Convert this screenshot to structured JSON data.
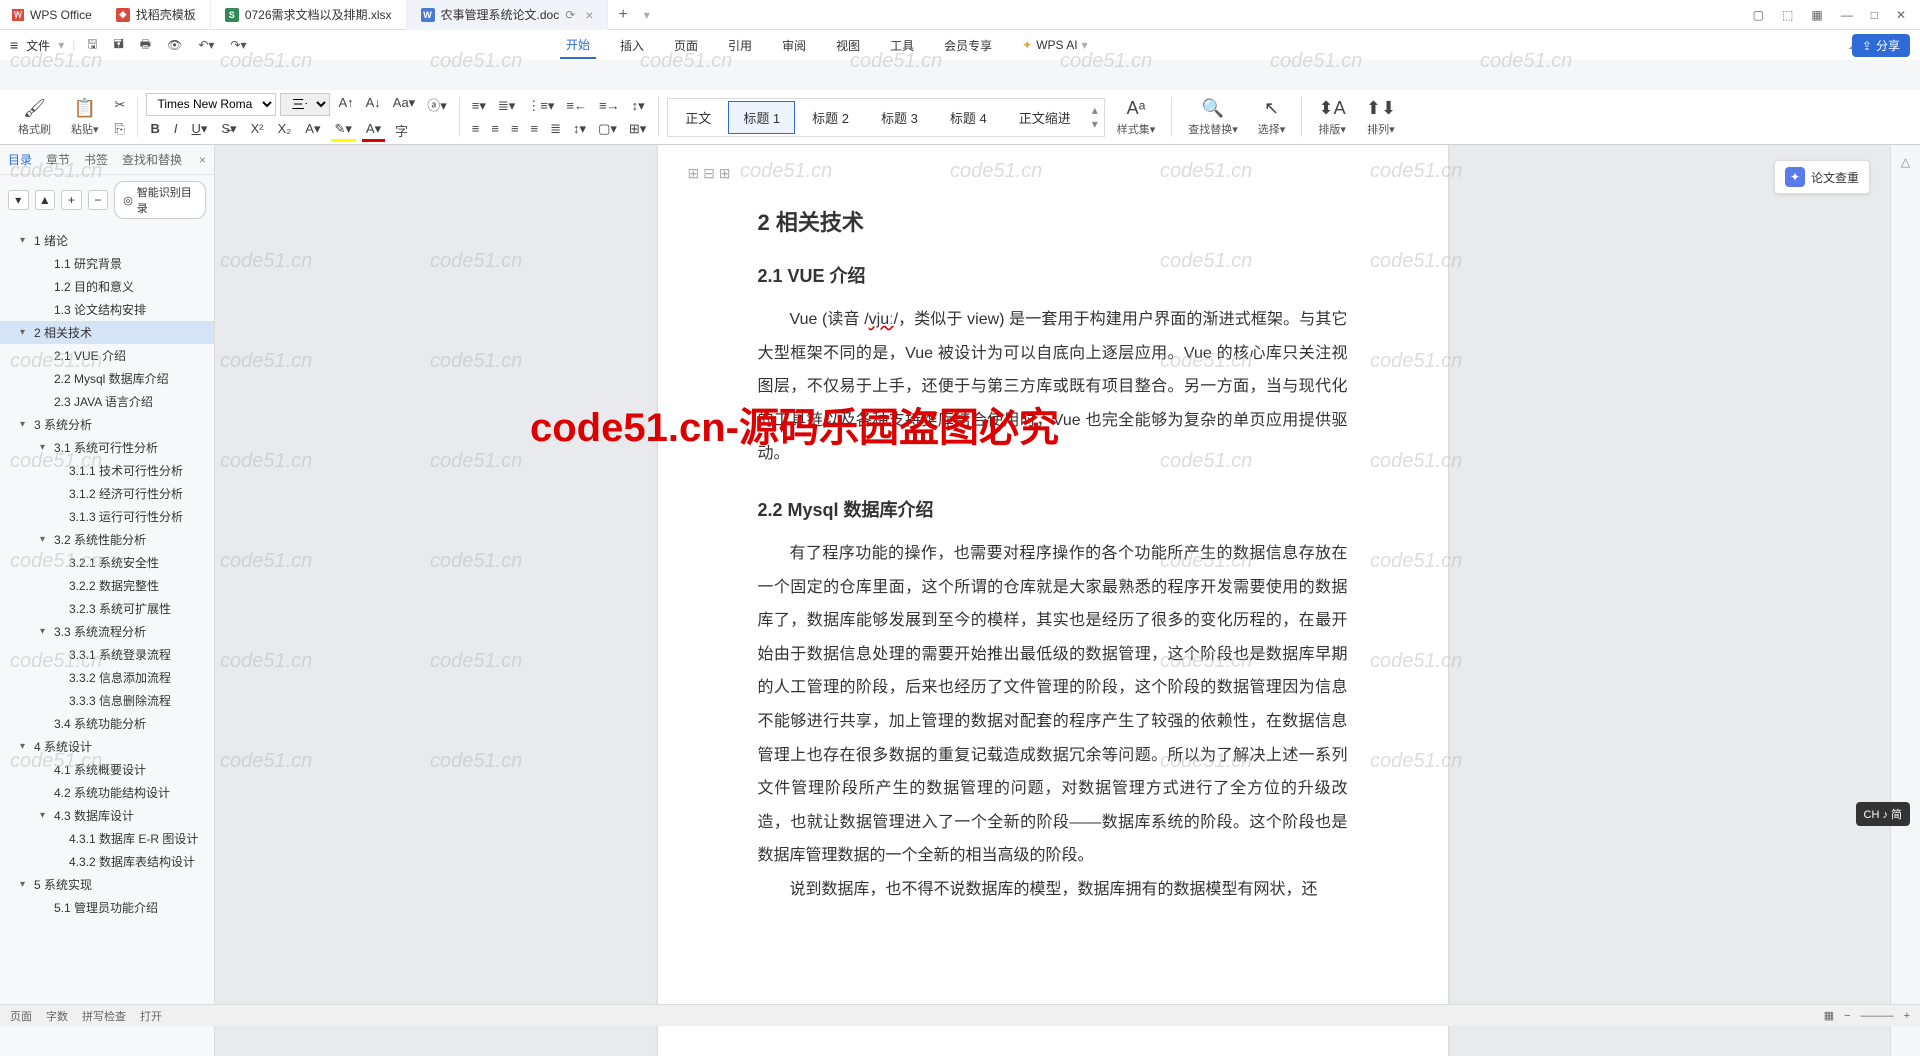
{
  "app": {
    "name": "WPS Office"
  },
  "tabs": [
    {
      "label": "找稻壳模板",
      "iconColor": "#d94b3f"
    },
    {
      "label": "0726需求文档以及排期.xlsx",
      "iconColor": "#2e8b57",
      "iconText": "S"
    },
    {
      "label": "农事管理系统论文.doc",
      "iconColor": "#4a7bd0",
      "iconText": "W",
      "active": true
    }
  ],
  "fileMenu": {
    "label": "文件"
  },
  "menuTabs": [
    "开始",
    "插入",
    "页面",
    "引用",
    "审阅",
    "视图",
    "工具",
    "会员专享"
  ],
  "wpsAI": "WPS AI",
  "shareBtn": "分享",
  "ribbon": {
    "formatPainter": "格式刷",
    "paste": "粘贴",
    "fontName": "Times New Roma",
    "fontSize": "三号",
    "styles": [
      "正文",
      "标题 1",
      "标题 2",
      "标题 3",
      "标题 4",
      "正文缩进"
    ],
    "activeStyle": 1,
    "styleSet": "样式集",
    "findReplace": "查找替换",
    "select": "选择",
    "arrange": "排版",
    "sort": "排列"
  },
  "nav": {
    "tabs": [
      "目录",
      "章节",
      "书签",
      "查找和替换"
    ],
    "smartToc": "智能识别目录",
    "toc": [
      {
        "txt": "1 绪论",
        "lvl": 0,
        "caret": "▾"
      },
      {
        "txt": "1.1 研究背景",
        "lvl": 1
      },
      {
        "txt": "1.2 目的和意义",
        "lvl": 1
      },
      {
        "txt": "1.3 论文结构安排",
        "lvl": 1
      },
      {
        "txt": "2 相关技术",
        "lvl": 0,
        "caret": "▾",
        "selected": true
      },
      {
        "txt": "2.1 VUE 介绍",
        "lvl": 1
      },
      {
        "txt": "2.2 Mysql 数据库介绍",
        "lvl": 1
      },
      {
        "txt": "2.3 JAVA 语言介绍",
        "lvl": 1
      },
      {
        "txt": "3 系统分析",
        "lvl": 0,
        "caret": "▾"
      },
      {
        "txt": "3.1 系统可行性分析",
        "lvl": 1,
        "caret": "▾"
      },
      {
        "txt": "3.1.1 技术可行性分析",
        "lvl": 2
      },
      {
        "txt": "3.1.2 经济可行性分析",
        "lvl": 2
      },
      {
        "txt": "3.1.3 运行可行性分析",
        "lvl": 2
      },
      {
        "txt": "3.2 系统性能分析",
        "lvl": 1,
        "caret": "▾"
      },
      {
        "txt": "3.2.1 系统安全性",
        "lvl": 2
      },
      {
        "txt": "3.2.2 数据完整性",
        "lvl": 2
      },
      {
        "txt": "3.2.3 系统可扩展性",
        "lvl": 2
      },
      {
        "txt": "3.3 系统流程分析",
        "lvl": 1,
        "caret": "▾"
      },
      {
        "txt": "3.3.1 系统登录流程",
        "lvl": 2
      },
      {
        "txt": "3.3.2 信息添加流程",
        "lvl": 2
      },
      {
        "txt": "3.3.3 信息删除流程",
        "lvl": 2
      },
      {
        "txt": "3.4 系统功能分析",
        "lvl": 1
      },
      {
        "txt": "4 系统设计",
        "lvl": 0,
        "caret": "▾"
      },
      {
        "txt": "4.1 系统概要设计",
        "lvl": 1
      },
      {
        "txt": "4.2 系统功能结构设计",
        "lvl": 1
      },
      {
        "txt": "4.3 数据库设计",
        "lvl": 1,
        "caret": "▾"
      },
      {
        "txt": "4.3.1 数据库 E-R 图设计",
        "lvl": 2
      },
      {
        "txt": "4.3.2 数据库表结构设计",
        "lvl": 2
      },
      {
        "txt": "5 系统实现",
        "lvl": 0,
        "caret": "▾"
      },
      {
        "txt": "5.1 管理员功能介绍",
        "lvl": 1
      }
    ]
  },
  "doc": {
    "h2": "2 相关技术",
    "h3a": "2.1 VUE 介绍",
    "p1_pre": "Vue (读音 /",
    "p1_wavy": "vjuː",
    "p1_post": "/，类似于 view)  是一套用于构建用户界面的渐进式框架。与其它大型框架不同的是，Vue 被设计为可以自底向上逐层应用。Vue 的核心库只关注视图层，不仅易于上手，还便于与第三方库或既有项目整合。另一方面，当与现代化的工具链以及各种支持类库结合使用时，Vue 也完全能够为复杂的单页应用提供驱动。",
    "h3b": "2.2 Mysql 数据库介绍",
    "p2": "有了程序功能的操作，也需要对程序操作的各个功能所产生的数据信息存放在一个固定的仓库里面，这个所谓的仓库就是大家最熟悉的程序开发需要使用的数据库了，数据库能够发展到至今的模样，其实也是经历了很多的变化历程的，在最开始由于数据信息处理的需要开始推出最低级的数据管理，这个阶段也是数据库早期的人工管理的阶段，后来也经历了文件管理的阶段，这个阶段的数据管理因为信息不能够进行共享，加上管理的数据对配套的程序产生了较强的依赖性，在数据信息管理上也存在很多数据的重复记载造成数据冗余等问题。所以为了解决上述一系列文件管理阶段所产生的数据管理的问题，对数据管理方式进行了全方位的升级改造，也就让数据管理进入了一个全新的阶段——数据库系统的阶段。这个阶段也是数据库管理数据的一个全新的相当高级的阶段。",
    "p3": "说到数据库，也不得不说数据库的模型，数据库拥有的数据模型有网状，还"
  },
  "floatBtn": "论文查重",
  "ime": "CH ♪ 简",
  "watermarkText": "code51.cn",
  "watermarkRed": "code51.cn-源码乐园盗图必究",
  "status": {
    "page": "页面",
    "wordCount": "字数",
    "spellCheck": "拼写检查",
    "open": "打开"
  }
}
